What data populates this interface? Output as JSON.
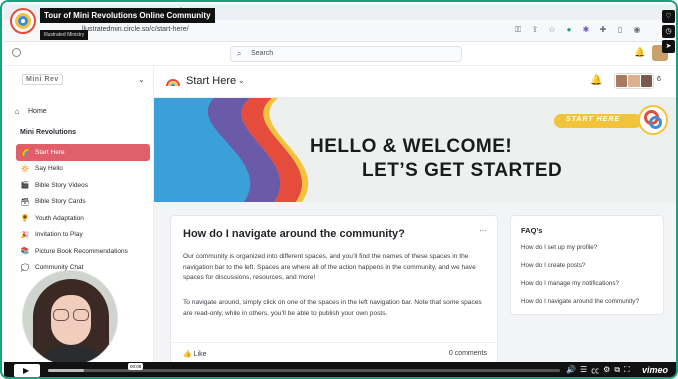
{
  "video": {
    "title": "Tour of Mini Revolutions Online Community",
    "channel": "Illustrated Ministry",
    "timestamp": "00:08",
    "progress": 0.07,
    "brand": "vimeo"
  },
  "browser": {
    "url": "llustratedmin.circle.so/c/start-here/"
  },
  "topbar": {
    "search_placeholder": "Search"
  },
  "sidebar": {
    "brand": "Mini Rev",
    "home_label": "Home",
    "section_label": "Mini Revolutions",
    "items": [
      {
        "label": "Start Here",
        "icon": "rainbow-icon",
        "glyph": "🌈",
        "active": true
      },
      {
        "label": "Say Hello",
        "icon": "sun-icon",
        "glyph": "🔆",
        "active": false
      },
      {
        "label": "Bible Story Videos",
        "icon": "clapper-icon",
        "glyph": "🎬",
        "active": false
      },
      {
        "label": "Bible Story Cards",
        "icon": "card-box-icon",
        "glyph": "🗃",
        "active": false
      },
      {
        "label": "Youth Adaptation",
        "icon": "flower-icon",
        "glyph": "🌻",
        "active": false
      },
      {
        "label": "Invitation to Play",
        "icon": "confetti-icon",
        "glyph": "🎉",
        "active": false
      },
      {
        "label": "Picture Book Recommendations",
        "icon": "books-icon",
        "glyph": "📚",
        "active": false
      },
      {
        "label": "Community Chat",
        "icon": "chat-icon",
        "glyph": "💭",
        "active": false
      }
    ]
  },
  "header": {
    "title": "Start Here",
    "member_count": "6"
  },
  "banner": {
    "line1": "HELLO & WELCOME!",
    "line2": "LET’S GET STARTED",
    "pill": "START HERE"
  },
  "post": {
    "title": "How do I navigate around the community?",
    "paragraph1": "Our community is organized into different spaces, and you’ll find the names of these spaces in the navigation bar to the left. Spaces are where all of the action happens in the community, and we have spaces for discussions, resources, and more!",
    "paragraph2": "To navigate around, simply click on one of the spaces in the left navigation bar. Note that some spaces are read-only, while in others, you’ll be able to publish your own posts.",
    "like_label": "Like",
    "comments_label": "0 comments"
  },
  "faq": {
    "title": "FAQ’s",
    "items": [
      "How do I set up my profile?",
      "How do I create posts?",
      "How do I manage my notifications?",
      "How do I navigate around the community?"
    ]
  }
}
